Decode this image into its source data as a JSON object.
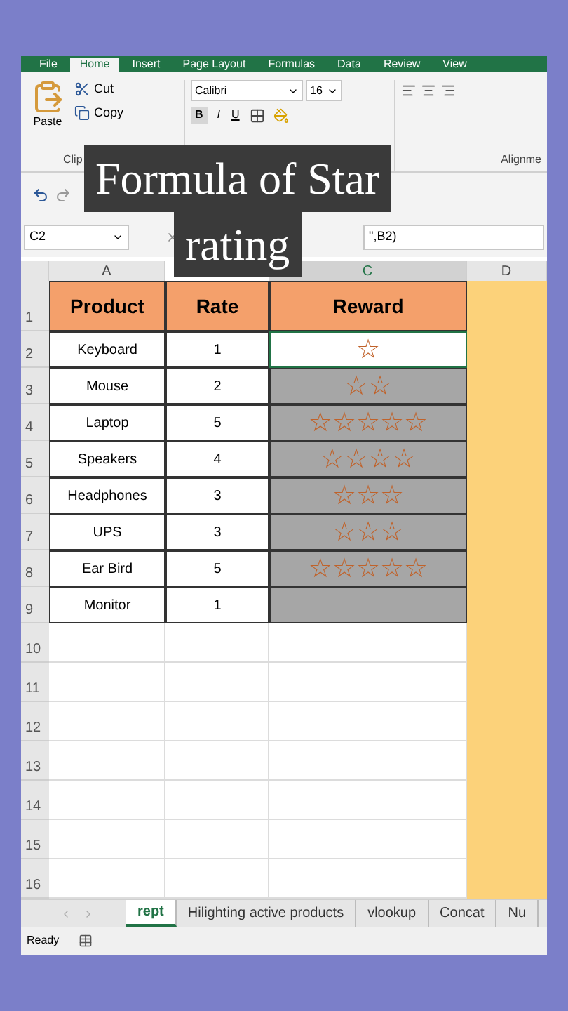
{
  "ribbon": {
    "tabs": [
      {
        "label": "File",
        "selected": false
      },
      {
        "label": "Home",
        "selected": true
      },
      {
        "label": "Insert",
        "selected": false
      },
      {
        "label": "Page Layout",
        "selected": false
      },
      {
        "label": "Formulas",
        "selected": false
      },
      {
        "label": "Data",
        "selected": false
      },
      {
        "label": "Review",
        "selected": false
      },
      {
        "label": "View",
        "selected": false
      }
    ],
    "clipboard": {
      "paste": "Paste",
      "cut": "Cut",
      "copy": "Copy",
      "group_label": "Clip"
    },
    "font": {
      "name": "Calibri",
      "size": "16",
      "bold": "B",
      "italic": "I",
      "underline": "U"
    },
    "alignment": {
      "group_label": "Alignme"
    }
  },
  "formula_bar": {
    "name_box": "C2",
    "formula": "\",B2)"
  },
  "column_headers": [
    {
      "label": "A",
      "selected": false
    },
    {
      "label": "C",
      "selected": true
    },
    {
      "label": "D",
      "selected": false
    }
  ],
  "table": {
    "header_row": "1",
    "header": [
      "Product",
      "Rate",
      "Reward"
    ],
    "rows": [
      {
        "row": "2",
        "product": "Keyboard",
        "rate": "1",
        "reward": "☆",
        "selected": false
      },
      {
        "row": "3",
        "product": "Mouse",
        "rate": "2",
        "reward": "☆☆",
        "selected": true
      },
      {
        "row": "4",
        "product": "Laptop",
        "rate": "5",
        "reward": "☆☆☆☆☆",
        "selected": true
      },
      {
        "row": "5",
        "product": "Speakers",
        "rate": "4",
        "reward": "☆☆☆☆",
        "selected": true
      },
      {
        "row": "6",
        "product": "Headphones",
        "rate": "3",
        "reward": "☆☆☆",
        "selected": true
      },
      {
        "row": "7",
        "product": "UPS",
        "rate": "3",
        "reward": "☆☆☆",
        "selected": true
      },
      {
        "row": "8",
        "product": "Ear Bird",
        "rate": "5",
        "reward": "☆☆☆☆☆",
        "selected": true
      },
      {
        "row": "9",
        "product": "Monitor",
        "rate": "1",
        "selected": true
      }
    ]
  },
  "empty_rows": [
    "10",
    "11",
    "12",
    "13",
    "14",
    "15",
    "16"
  ],
  "sheet_tabs": [
    {
      "label": "rept",
      "selected": true
    },
    {
      "label": "Hilighting active products",
      "selected": false
    },
    {
      "label": "vlookup",
      "selected": false
    },
    {
      "label": "Concat",
      "selected": false
    },
    {
      "label": "Nu",
      "selected": false
    }
  ],
  "status_bar": {
    "text": "Ready"
  },
  "caption": [
    "Formula of Star",
    "rating"
  ]
}
